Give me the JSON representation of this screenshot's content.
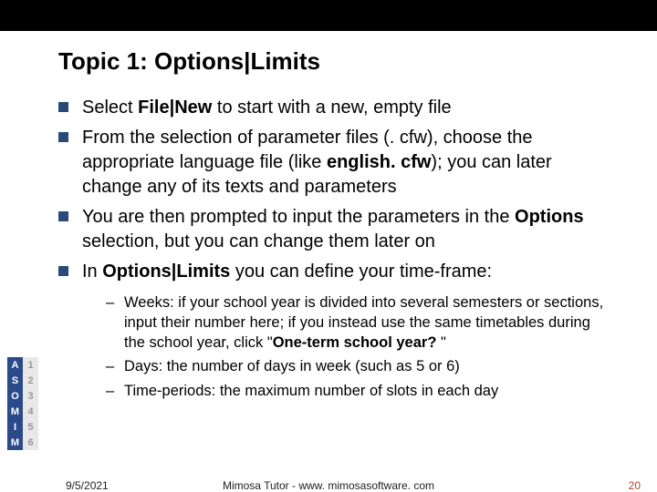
{
  "title": "Topic 1: Options|Limits",
  "bullets": {
    "b1a": "Select ",
    "b1b": "File|New",
    "b1c": " to start with a new, empty file",
    "b2a": "From the selection of parameter files (. cfw), choose the appropriate language file (like ",
    "b2b": "english. cfw",
    "b2c": "); you can later change any of its texts and parameters",
    "b3a": "You are then prompted to input the parameters in the ",
    "b3b": "Options",
    "b3c": " selection, but you can change them later on",
    "b4a": "In ",
    "b4b": "Options|Limits",
    "b4c": " you can define your time-frame:"
  },
  "sub": {
    "s1a": "Weeks: if your school year is divided into several semesters or sections, input their number here; if you instead use the same timetables during the school year, click \"",
    "s1b": "One-term school year? ",
    "s1c": "\"",
    "s2": "Days: the number of days in week (such as 5 or 6)",
    "s3": "Time-periods: the maximum number of slots in each day"
  },
  "footer": {
    "date": "9/5/2021",
    "center": "Mimosa Tutor - www. mimosasoftware. com",
    "page": "20"
  },
  "logo": {
    "letters": [
      "A",
      "S",
      "O",
      "M",
      "I",
      "M"
    ],
    "nums": [
      "1",
      "2",
      "3",
      "4",
      "5",
      "6"
    ]
  }
}
